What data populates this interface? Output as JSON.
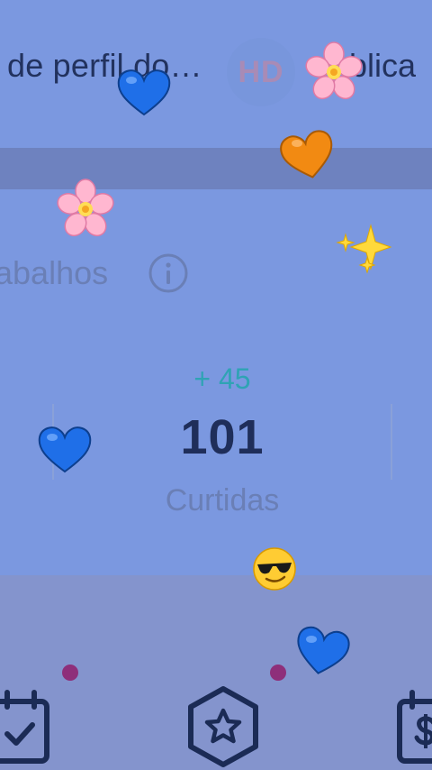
{
  "header": {
    "title_left": "de perfil do…",
    "hd_badge": "HD",
    "title_right": "blica"
  },
  "section": {
    "title": "abalhos"
  },
  "stat": {
    "delta": "+ 45",
    "value": "101",
    "label": "Curtidas"
  },
  "icons": {
    "info": "info-icon",
    "calendar_check": "calendar-check-icon",
    "star_badge": "star-badge-icon",
    "calendar_dollar": "calendar-dollar-icon"
  },
  "colors": {
    "background": "#7b98e0",
    "band": "#6e82bf",
    "lower": "#8494cd",
    "delta": "#2fa3b4",
    "text_dark": "#1f2e5a",
    "text_muted": "#6a7fb6",
    "dot": "#8e2f7a"
  }
}
